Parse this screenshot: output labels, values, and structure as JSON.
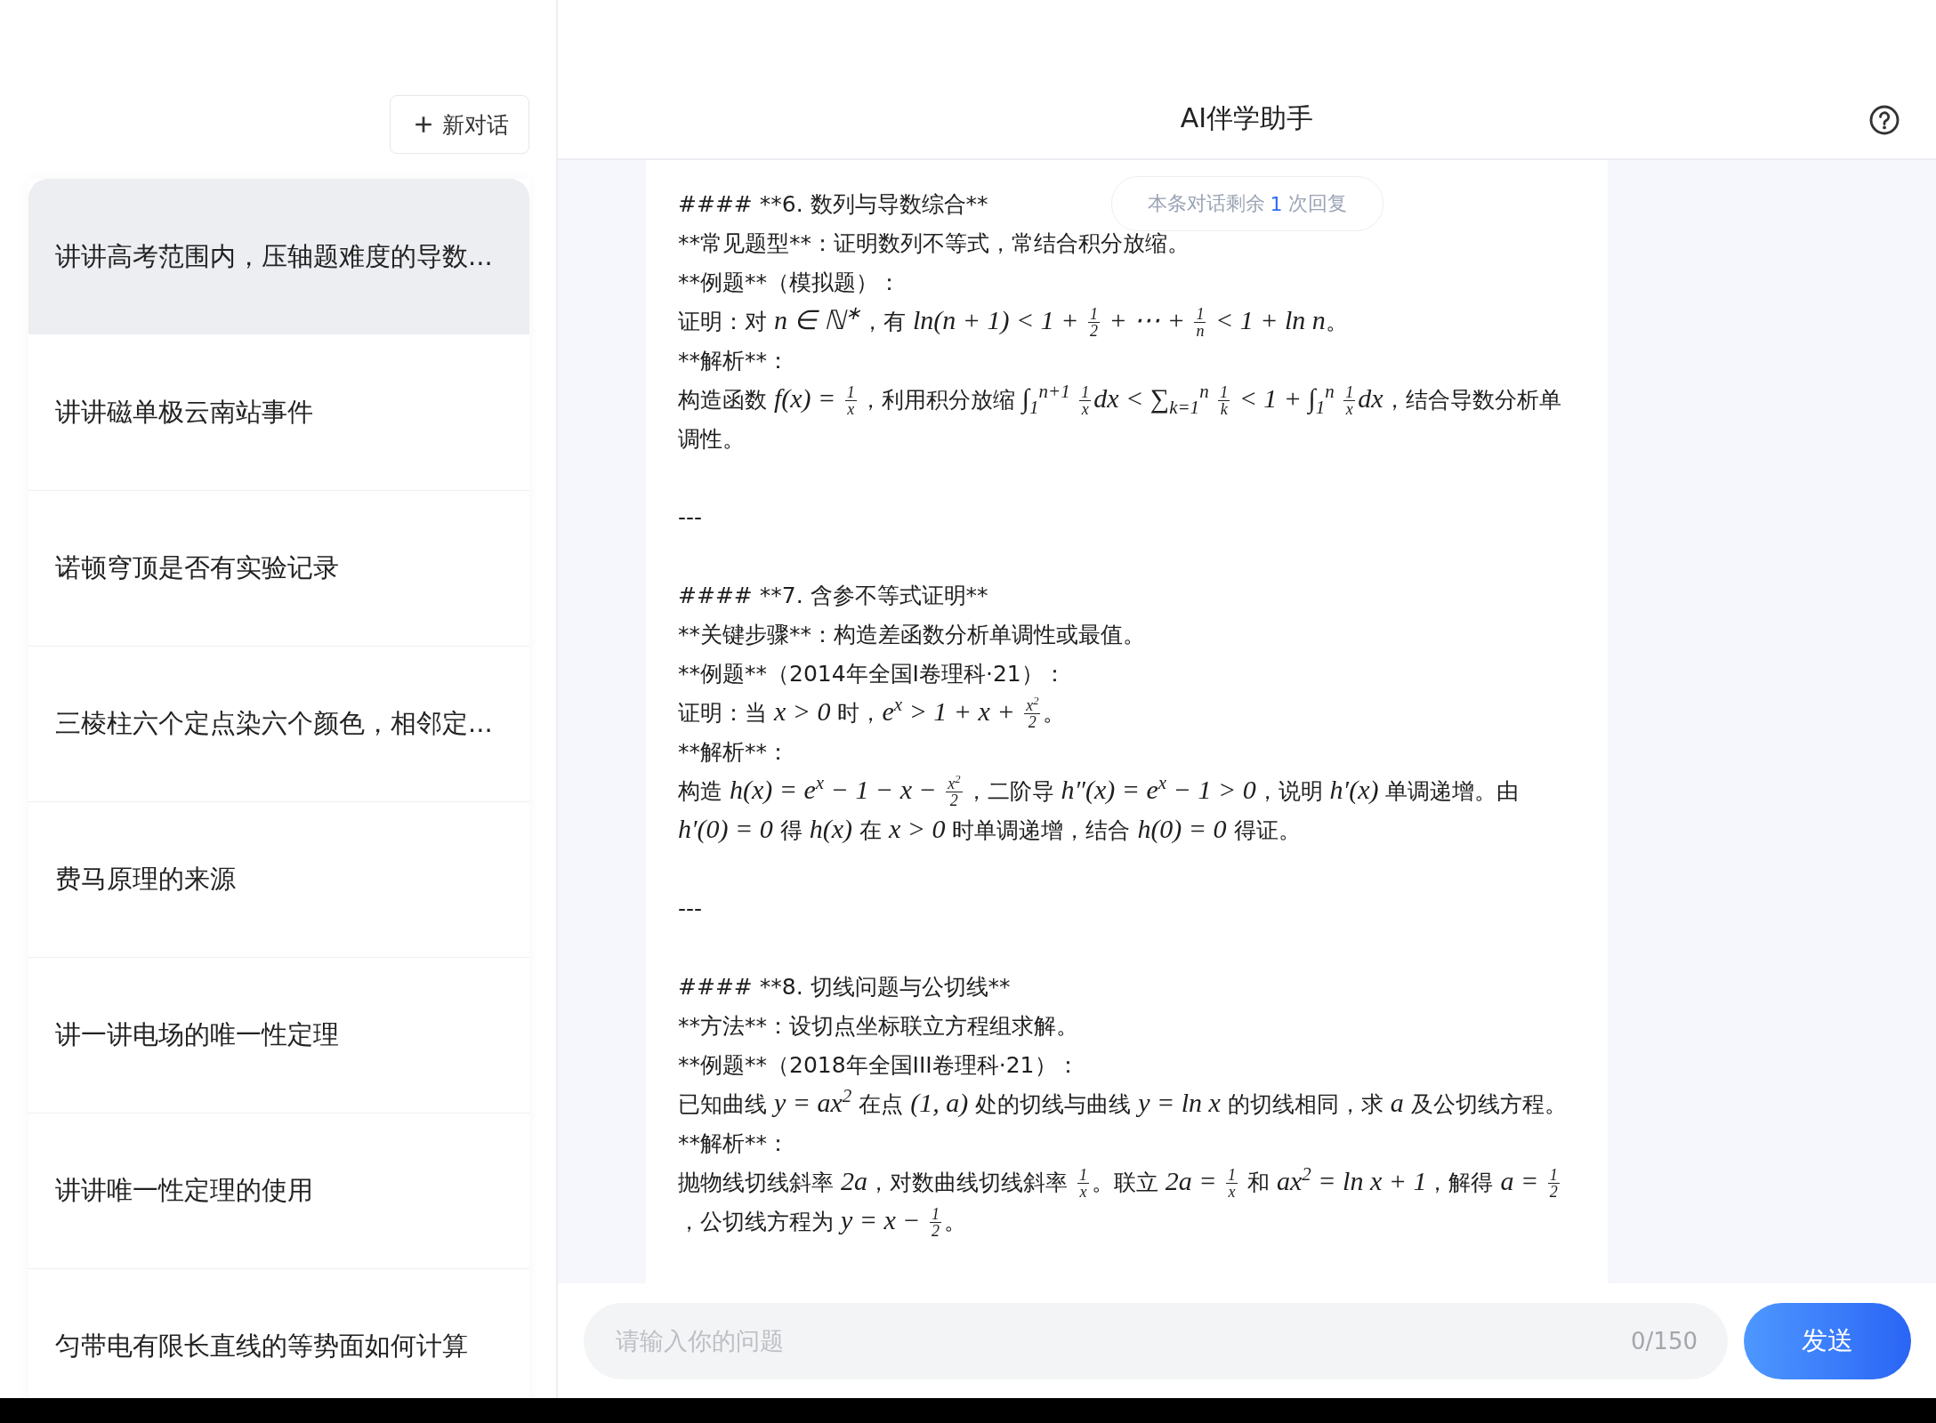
{
  "sidebar": {
    "new_chat_button": "新对话",
    "items": [
      {
        "text": "讲讲高考范围内，压轴题难度的导数...",
        "selected": true
      },
      {
        "text": "讲讲磁单极云南站事件",
        "selected": false
      },
      {
        "text": "诺顿穹顶是否有实验记录",
        "selected": false
      },
      {
        "text": "三棱柱六个定点染六个颜色，相邻定...",
        "selected": false
      },
      {
        "text": "费马原理的来源",
        "selected": false
      },
      {
        "text": "讲一讲电场的唯一性定理",
        "selected": false
      },
      {
        "text": "讲讲唯一性定理的使用",
        "selected": false
      },
      {
        "text": "匀带电有限长直线的等势面如何计算",
        "selected": false
      }
    ]
  },
  "header": {
    "title": "AI伴学助手"
  },
  "notice": {
    "prefix": "本条对话剩余",
    "count": "1",
    "suffix": "次回复"
  },
  "message": {
    "blocks": [
      {
        "kind": "heading",
        "text": "#### **6. 数列与导数综合**"
      },
      {
        "kind": "plain",
        "text": "**常见题型**：证明数列不等式，常结合积分放缩。"
      },
      {
        "kind": "plain",
        "text": "**例题**（模拟题）："
      },
      {
        "kind": "mixed",
        "parts": [
          {
            "kind": "text",
            "text": "证明：对 "
          },
          {
            "kind": "math",
            "text": "n ∈ ℕ$^{∗}$"
          },
          {
            "kind": "text",
            "text": "，有 "
          },
          {
            "kind": "math",
            "text": "ln(n + 1) < 1 + "
          },
          {
            "kind": "frac",
            "num": "1",
            "den": "2"
          },
          {
            "kind": "math",
            "text": " + ⋯ + "
          },
          {
            "kind": "frac",
            "num": "1",
            "den": "n"
          },
          {
            "kind": "math",
            "text": " < 1 + ln n"
          },
          {
            "kind": "text",
            "text": "。"
          }
        ]
      },
      {
        "kind": "plain",
        "text": "**解析**："
      },
      {
        "kind": "mixed",
        "parts": [
          {
            "kind": "text",
            "text": "构造函数 "
          },
          {
            "kind": "math",
            "text": "f(x) = "
          },
          {
            "kind": "frac",
            "num": "1",
            "den": "x"
          },
          {
            "kind": "text",
            "text": "，利用积分放缩 "
          },
          {
            "kind": "math",
            "text": "∫$_{1}$$^{n+1}$ "
          },
          {
            "kind": "frac",
            "num": "1",
            "den": "x"
          },
          {
            "kind": "math",
            "text": "dx < ∑$_{k=1}$$^{n}$ "
          },
          {
            "kind": "frac",
            "num": "1",
            "den": "k"
          },
          {
            "kind": "math",
            "text": " < 1 + ∫$_{1}$$^{n}$ "
          },
          {
            "kind": "frac",
            "num": "1",
            "den": "x"
          },
          {
            "kind": "math",
            "text": "dx"
          },
          {
            "kind": "text",
            "text": "，结合导数分析单调性。"
          }
        ]
      },
      {
        "kind": "rule",
        "text": "---"
      },
      {
        "kind": "heading",
        "text": "#### **7. 含参不等式证明**"
      },
      {
        "kind": "plain",
        "text": "**关键步骤**：构造差函数分析单调性或最值。"
      },
      {
        "kind": "plain",
        "text": "**例题**（2014年全国I卷理科·21）："
      },
      {
        "kind": "mixed",
        "parts": [
          {
            "kind": "text",
            "text": "证明：当 "
          },
          {
            "kind": "math",
            "text": "x > 0"
          },
          {
            "kind": "text",
            "text": " 时，"
          },
          {
            "kind": "math",
            "text": "e$^{x}$ > 1 + x + "
          },
          {
            "kind": "frac",
            "num": "x$^{2}$",
            "den": "2"
          },
          {
            "kind": "text",
            "text": "。"
          }
        ]
      },
      {
        "kind": "plain",
        "text": "**解析**："
      },
      {
        "kind": "mixed",
        "parts": [
          {
            "kind": "text",
            "text": "构造 "
          },
          {
            "kind": "math",
            "text": "h(x) = e$^{x}$ − 1 − x − "
          },
          {
            "kind": "frac",
            "num": "x$^{2}$",
            "den": "2"
          },
          {
            "kind": "text",
            "text": "，二阶导 "
          },
          {
            "kind": "math",
            "text": "h″(x) = e$^{x}$ − 1 > 0"
          },
          {
            "kind": "text",
            "text": "，说明 "
          },
          {
            "kind": "math",
            "text": "h′(x)"
          },
          {
            "kind": "text",
            "text": " 单调递增。由 "
          },
          {
            "kind": "math",
            "text": "h′(0) = 0"
          },
          {
            "kind": "text",
            "text": " 得 "
          },
          {
            "kind": "math",
            "text": "h(x)"
          },
          {
            "kind": "text",
            "text": " 在 "
          },
          {
            "kind": "math",
            "text": "x > 0"
          },
          {
            "kind": "text",
            "text": " 时单调递增，结合 "
          },
          {
            "kind": "math",
            "text": "h(0) = 0"
          },
          {
            "kind": "text",
            "text": " 得证。"
          }
        ]
      },
      {
        "kind": "rule",
        "text": "---"
      },
      {
        "kind": "heading",
        "text": "#### **8. 切线问题与公切线**"
      },
      {
        "kind": "plain",
        "text": "**方法**：设切点坐标联立方程组求解。"
      },
      {
        "kind": "plain",
        "text": "**例题**（2018年全国III卷理科·21）："
      },
      {
        "kind": "mixed",
        "parts": [
          {
            "kind": "text",
            "text": "已知曲线 "
          },
          {
            "kind": "math",
            "text": "y = ax$^{2}$"
          },
          {
            "kind": "text",
            "text": " 在点 "
          },
          {
            "kind": "math",
            "text": "(1, a)"
          },
          {
            "kind": "text",
            "text": " 处的切线与曲线 "
          },
          {
            "kind": "math",
            "text": "y = ln x"
          },
          {
            "kind": "text",
            "text": " 的切线相同，求 "
          },
          {
            "kind": "math",
            "text": "a"
          },
          {
            "kind": "text",
            "text": " 及公切线方程。"
          }
        ]
      },
      {
        "kind": "plain",
        "text": "**解析**："
      },
      {
        "kind": "mixed",
        "parts": [
          {
            "kind": "text",
            "text": "抛物线切线斜率 "
          },
          {
            "kind": "math",
            "text": "2a"
          },
          {
            "kind": "text",
            "text": "，对数曲线切线斜率 "
          },
          {
            "kind": "frac",
            "num": "1",
            "den": "x"
          },
          {
            "kind": "text",
            "text": "。联立 "
          },
          {
            "kind": "math",
            "text": "2a = "
          },
          {
            "kind": "frac",
            "num": "1",
            "den": "x"
          },
          {
            "kind": "text",
            "text": " 和 "
          },
          {
            "kind": "math",
            "text": "ax$^{2}$ = ln x + 1"
          },
          {
            "kind": "text",
            "text": "，解得 "
          },
          {
            "kind": "math",
            "text": "a = "
          },
          {
            "kind": "frac",
            "num": "1",
            "den": "2"
          },
          {
            "kind": "text",
            "text": "，公切线方程为 "
          },
          {
            "kind": "math",
            "text": "y = x − "
          },
          {
            "kind": "frac",
            "num": "1",
            "den": "2"
          },
          {
            "kind": "text",
            "text": "。"
          }
        ]
      }
    ]
  },
  "input": {
    "placeholder": "请输入你的问题",
    "counter": "0/150",
    "send_button": "发送"
  }
}
